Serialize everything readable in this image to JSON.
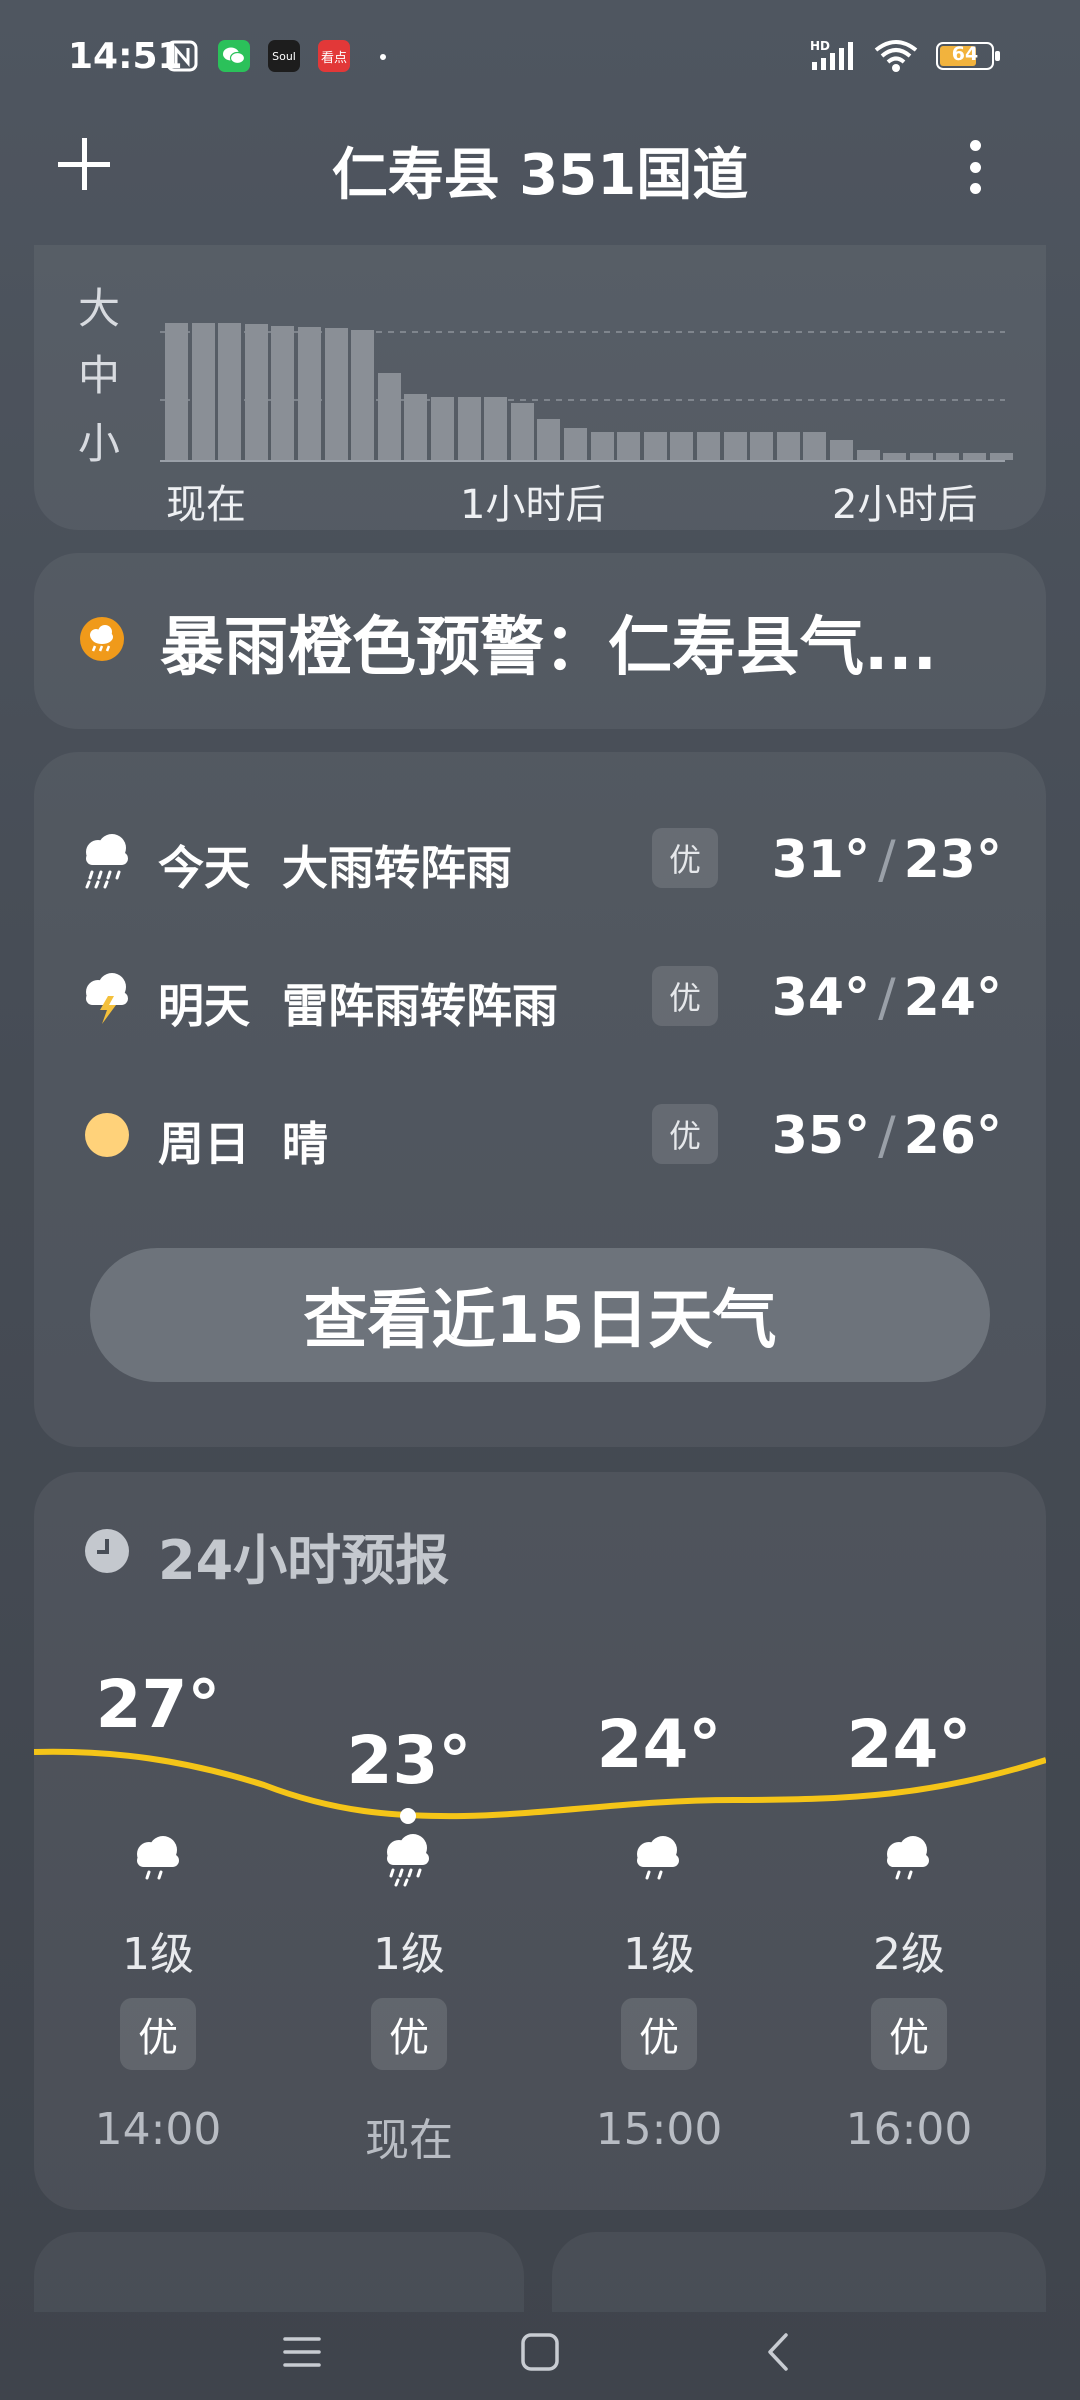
{
  "status_bar": {
    "time": "14:51",
    "battery": "64",
    "network": "HD",
    "app_icons": [
      "wechat-icon",
      "soul-icon",
      "kandian-icon"
    ],
    "soul_text": "Soul",
    "kandian_text": "看点"
  },
  "header": {
    "title": "仁寿县 351国道"
  },
  "precipitation": {
    "levels": [
      "大",
      "中",
      "小"
    ],
    "time_labels": [
      "现在",
      "1小时后",
      "2小时后"
    ],
    "bar_levels": [
      0.98,
      0.98,
      0.98,
      0.97,
      0.96,
      0.95,
      0.94,
      0.93,
      0.62,
      0.47,
      0.45,
      0.45,
      0.45,
      0.41,
      0.29,
      0.23,
      0.2,
      0.2,
      0.2,
      0.2,
      0.2,
      0.2,
      0.2,
      0.2,
      0.2,
      0.14,
      0.07,
      0.05,
      0.05,
      0.05,
      0.05,
      0.05
    ]
  },
  "warning": {
    "text": "暴雨橙色预警：仁寿县气..."
  },
  "daily": [
    {
      "day": "今天",
      "desc": "大雨转阵雨",
      "aqi": "优",
      "high": "31°",
      "low": "23°",
      "icon": "heavy-rain-icon"
    },
    {
      "day": "明天",
      "desc": "雷阵雨转阵雨",
      "aqi": "优",
      "high": "34°",
      "low": "24°",
      "icon": "thunder-shower-icon"
    },
    {
      "day": "周日",
      "desc": "晴",
      "aqi": "优",
      "high": "35°",
      "low": "26°",
      "icon": "sunny-icon"
    }
  ],
  "view_15_days": "查看近15日天气",
  "hourly": {
    "title": "24小时预报",
    "items": [
      {
        "temp": "27°",
        "wind": "1级",
        "aqi": "优",
        "time": "14:00",
        "icon": "rain-icon"
      },
      {
        "temp": "23°",
        "wind": "1级",
        "aqi": "优",
        "time": "现在",
        "icon": "heavy-rain-icon"
      },
      {
        "temp": "24°",
        "wind": "1级",
        "aqi": "优",
        "time": "15:00",
        "icon": "rain-icon"
      },
      {
        "temp": "24°",
        "wind": "2级",
        "aqi": "优",
        "time": "16:00",
        "icon": "rain-icon"
      }
    ]
  },
  "colors": {
    "temp_curve": "#f5c518",
    "warning_orange": "#f09a1a",
    "sun_yellow": "#ffd27a"
  }
}
